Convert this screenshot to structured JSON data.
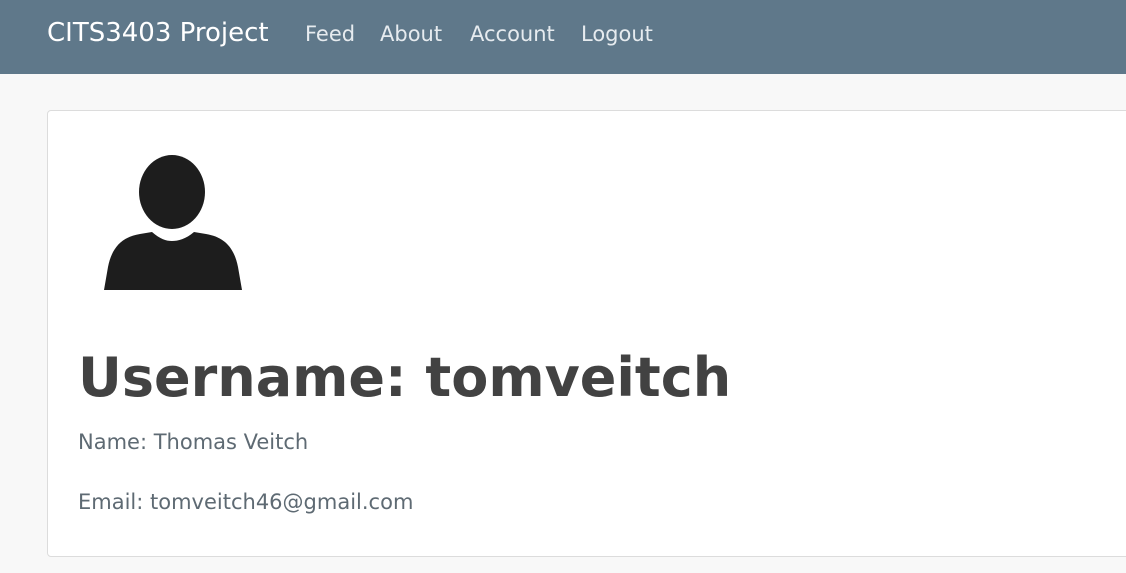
{
  "navbar": {
    "brand": "CITS3403 Project",
    "links": [
      {
        "label": "Feed"
      },
      {
        "label": "About"
      },
      {
        "label": "Account"
      },
      {
        "label": "Logout"
      }
    ]
  },
  "profile": {
    "avatar_icon": "user-silhouette-icon",
    "username": "Username: tomveitch",
    "name": "Name: Thomas Veitch",
    "email": "Email: tomveitch46@gmail.com"
  },
  "colors": {
    "navbar_bg": "#5f788a",
    "page_bg": "#f8f8f8",
    "heading_text": "#424242",
    "info_text": "#5e6a73"
  }
}
